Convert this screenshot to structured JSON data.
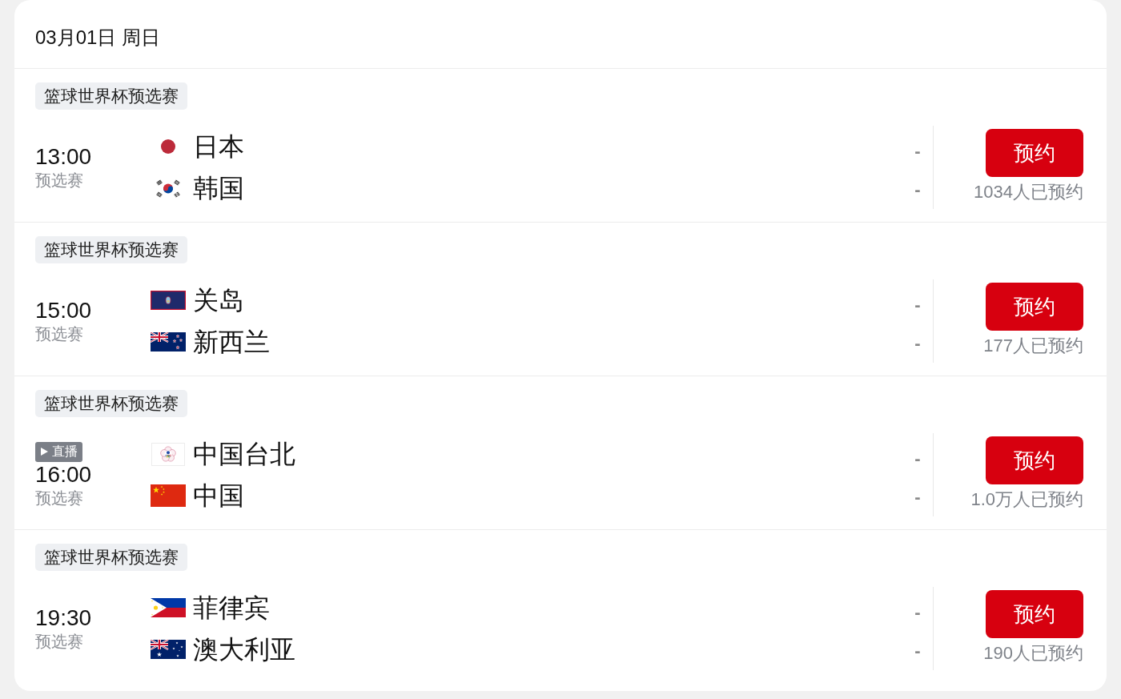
{
  "date_header": "03月01日 周日",
  "matches": [
    {
      "league": "篮球世界杯预选赛",
      "live": false,
      "time": "13:00",
      "stage": "预选赛",
      "teams": [
        {
          "name": "日本",
          "kind": "japan",
          "score": "-"
        },
        {
          "name": "韩国",
          "kind": "korea",
          "score": "-"
        }
      ],
      "button": "预约",
      "reservations": "1034人已预约"
    },
    {
      "league": "篮球世界杯预选赛",
      "live": false,
      "time": "15:00",
      "stage": "预选赛",
      "teams": [
        {
          "name": "关岛",
          "kind": "guam",
          "score": "-"
        },
        {
          "name": "新西兰",
          "kind": "newzealand",
          "score": "-"
        }
      ],
      "button": "预约",
      "reservations": "177人已预约"
    },
    {
      "league": "篮球世界杯预选赛",
      "live": true,
      "live_label": "直播",
      "time": "16:00",
      "stage": "预选赛",
      "teams": [
        {
          "name": "中国台北",
          "kind": "taipei",
          "score": "-"
        },
        {
          "name": "中国",
          "kind": "china",
          "score": "-"
        }
      ],
      "button": "预约",
      "reservations": "1.0万人已预约"
    },
    {
      "league": "篮球世界杯预选赛",
      "live": false,
      "time": "19:30",
      "stage": "预选赛",
      "teams": [
        {
          "name": "菲律宾",
          "kind": "philippines",
          "score": "-"
        },
        {
          "name": "澳大利亚",
          "kind": "australia",
          "score": "-"
        }
      ],
      "button": "预约",
      "reservations": "190人已预约"
    }
  ]
}
